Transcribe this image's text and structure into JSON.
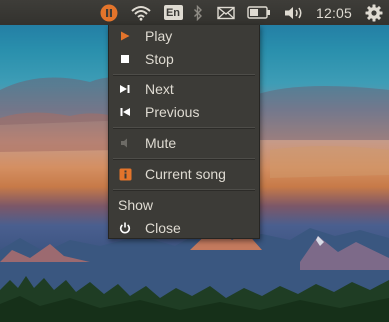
{
  "panel": {
    "clock": "12:05",
    "keyboard_layout": "En",
    "indicators": [
      "pause-icon",
      "wifi-icon",
      "keyboard-layout",
      "bluetooth-icon",
      "mail-icon",
      "battery-icon",
      "volume-icon",
      "clock",
      "gear-icon"
    ]
  },
  "menu": {
    "play": "Play",
    "stop": "Stop",
    "next": "Next",
    "previous": "Previous",
    "mute": "Mute",
    "current_song": "Current song",
    "show": "Show",
    "close": "Close"
  },
  "colors": {
    "panel": "#3c3b37",
    "menu": "#3c3b37",
    "text": "#dfdbd2",
    "accent_orange": "#e3742b"
  }
}
